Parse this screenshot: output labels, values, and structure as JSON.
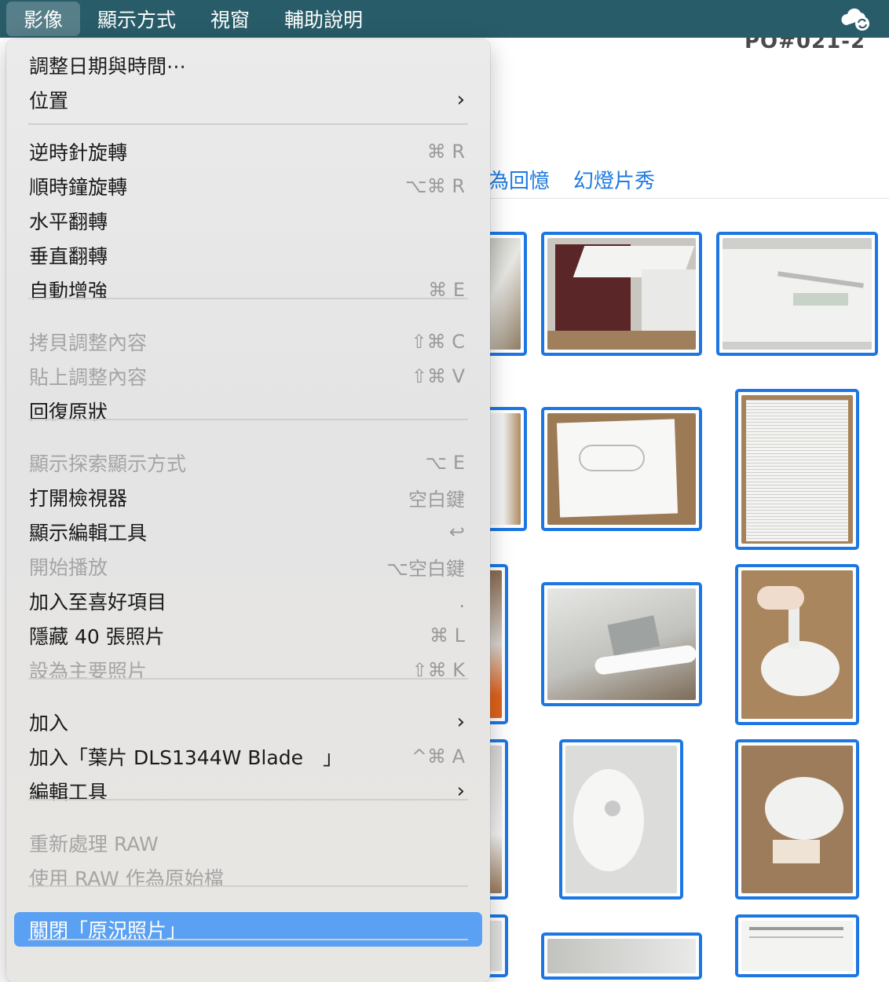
{
  "menubar": {
    "items": [
      "影像",
      "顯示方式",
      "視窗",
      "輔助說明"
    ],
    "status_icon": "cloud-sync-icon"
  },
  "background": {
    "title": "PO#021-2",
    "tabs": [
      "為回憶",
      "幻燈片秀"
    ]
  },
  "menu": {
    "items": [
      {
        "label": "調整日期與時間⋯",
        "shortcut": "",
        "disabled": false
      },
      {
        "label": "位置",
        "shortcut": "",
        "disabled": false,
        "submenu": true
      },
      {
        "label": "逆時針旋轉",
        "shortcut": "⌘ R",
        "disabled": false
      },
      {
        "label": "順時鐘旋轉",
        "shortcut": "⌥⌘ R",
        "disabled": false
      },
      {
        "label": "水平翻轉",
        "shortcut": "",
        "disabled": false
      },
      {
        "label": "垂直翻轉",
        "shortcut": "",
        "disabled": false
      },
      {
        "label": "自動增強",
        "shortcut": "⌘ E",
        "disabled": false
      },
      {
        "label": "拷貝調整內容",
        "shortcut": "⇧⌘ C",
        "disabled": true
      },
      {
        "label": "貼上調整內容",
        "shortcut": "⇧⌘ V",
        "disabled": true
      },
      {
        "label": "回復原狀",
        "shortcut": "",
        "disabled": false
      },
      {
        "label": "顯示探索顯示方式",
        "shortcut": "⌥ E",
        "disabled": true
      },
      {
        "label": "打開檢視器",
        "shortcut": "空白鍵",
        "disabled": false
      },
      {
        "label": "顯示編輯工具",
        "shortcut": "↩",
        "disabled": false
      },
      {
        "label": "開始播放",
        "shortcut": "⌥空白鍵",
        "disabled": true
      },
      {
        "label": "加入至喜好項目",
        "shortcut": ".",
        "disabled": false
      },
      {
        "label": "隱藏 40 張照片",
        "shortcut": "⌘ L",
        "disabled": false
      },
      {
        "label": "設為主要照片",
        "shortcut": "⇧⌘ K",
        "disabled": true
      },
      {
        "label": "加入",
        "shortcut": "",
        "disabled": false,
        "submenu": true
      },
      {
        "label": "加入「葉片 DLS1344W Blade　」",
        "shortcut": "^⌘ A",
        "disabled": false
      },
      {
        "label": "編輯工具",
        "shortcut": "",
        "disabled": false,
        "submenu": true
      },
      {
        "label": "重新處理 RAW",
        "shortcut": "",
        "disabled": true
      },
      {
        "label": "使用 RAW 作為原始檔",
        "shortcut": "",
        "disabled": true
      },
      {
        "label": "關閉「原況照片」",
        "shortcut": "",
        "disabled": false,
        "highlighted": true
      }
    ],
    "submenu_arrow": "›"
  },
  "colors": {
    "menubar": "#285c68",
    "selection_border": "#1c76e3",
    "highlight": "#5aa0f3",
    "tab_text": "#1f7ae0"
  }
}
